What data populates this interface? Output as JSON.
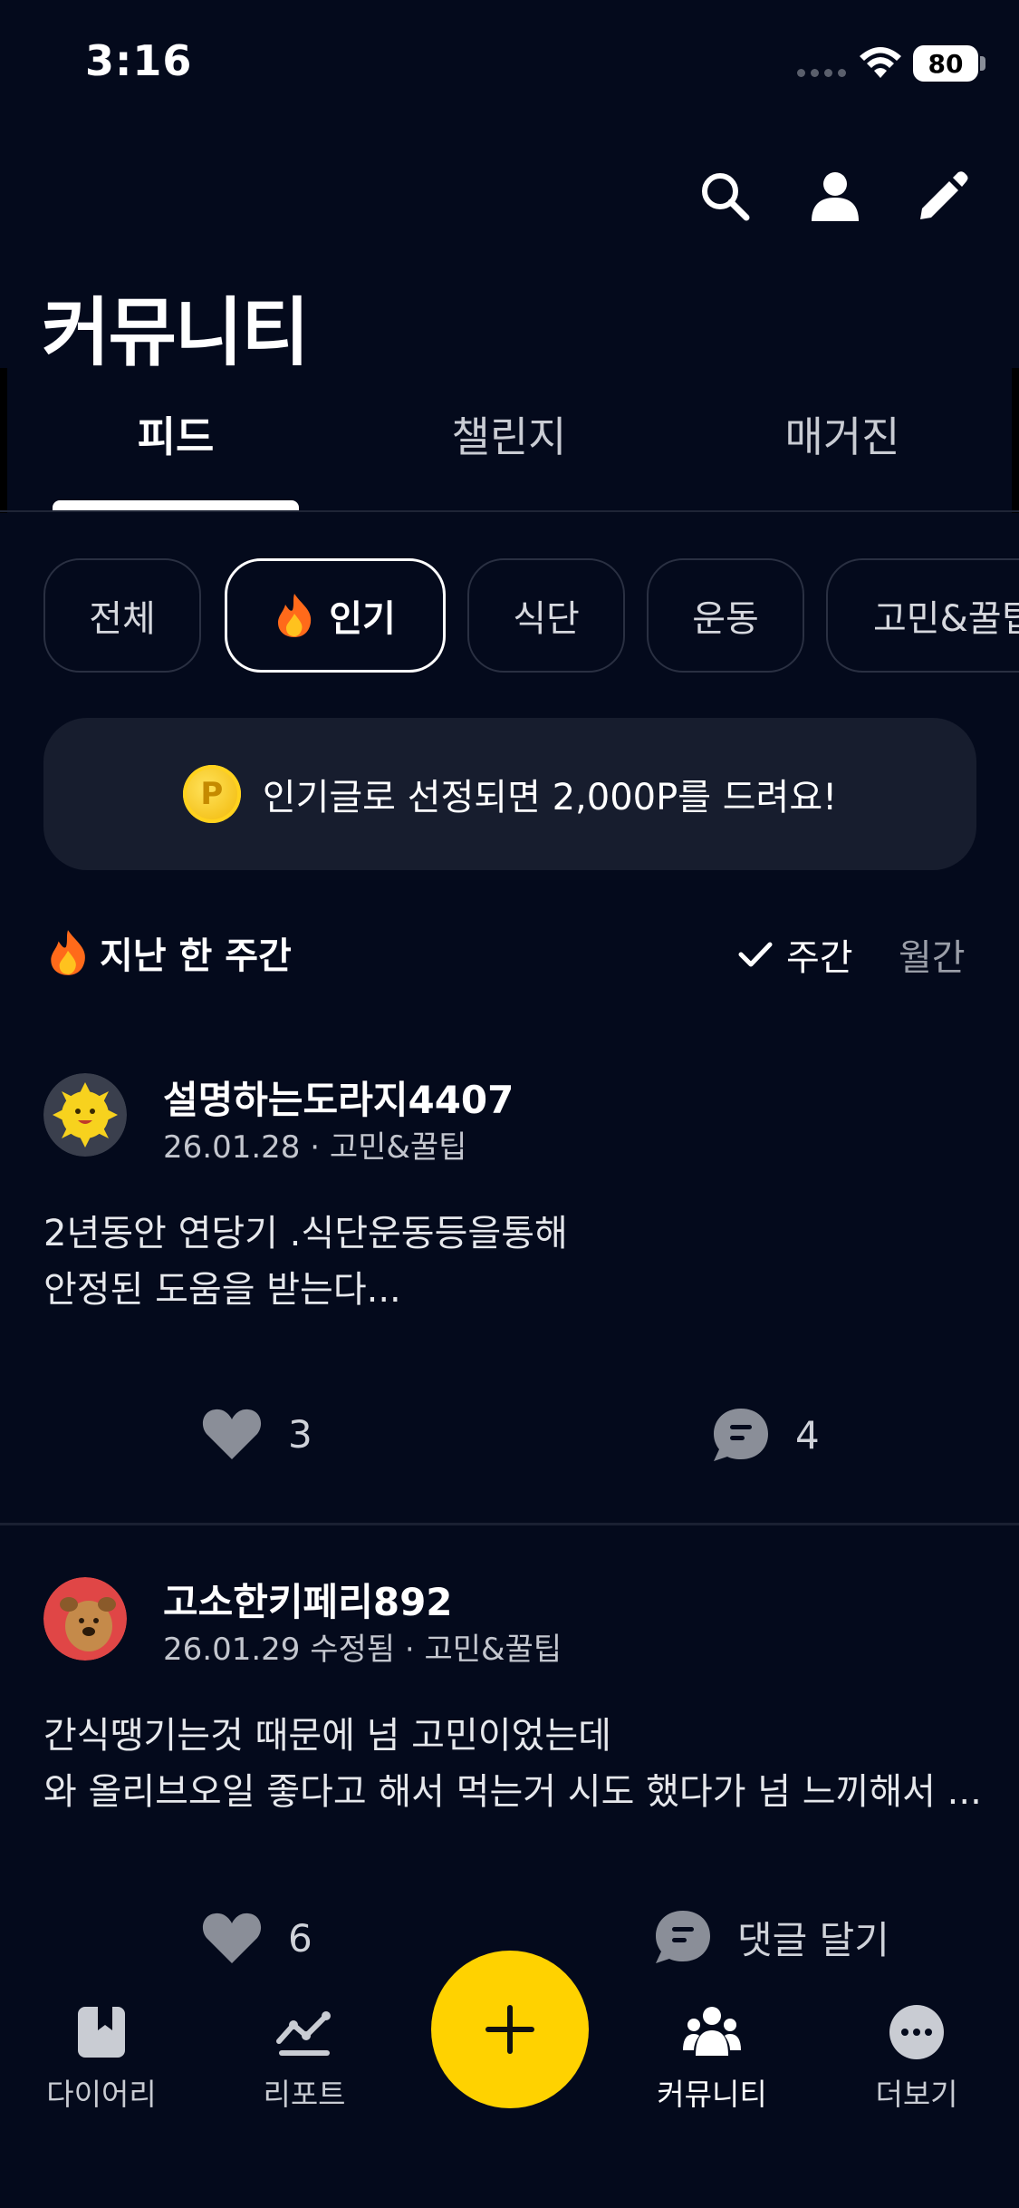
{
  "status_bar": {
    "time": "3:16",
    "battery": "80"
  },
  "header": {
    "title": "커뮤니티",
    "icons": [
      "search-icon",
      "profile-icon",
      "write-icon"
    ]
  },
  "tabs": [
    {
      "label": "피드",
      "active": true
    },
    {
      "label": "챌린지",
      "active": false
    },
    {
      "label": "매거진",
      "active": false
    }
  ],
  "chips": [
    {
      "label": "전체",
      "active": false
    },
    {
      "label": "인기",
      "active": true,
      "icon": "fire-icon"
    },
    {
      "label": "식단",
      "active": false
    },
    {
      "label": "운동",
      "active": false
    },
    {
      "label": "고민&꿀팁",
      "active": false
    }
  ],
  "banner": {
    "text": "인기글로 선정되면 2,000P를 드려요!",
    "coin_label": "P"
  },
  "section": {
    "title": "지난 한 주간",
    "periods": [
      {
        "label": "주간",
        "selected": true
      },
      {
        "label": "월간",
        "selected": false
      }
    ]
  },
  "posts": [
    {
      "author": "설명하는도라지4407",
      "meta": "26.01.28 · 고민&꿀팁",
      "lines": [
        "2년동안 연당기 .식단운동등을통해",
        "안정된 도움을 받는다..."
      ],
      "likes": "3",
      "comments": "4"
    },
    {
      "author": "고소한키페리892",
      "meta": "26.01.29 수정됨 · 고민&꿀팁",
      "lines": [
        "간식땡기는것 때문에 넘 고민이었는데",
        "와 올리브오일 좋다고 해서 먹는거 시도 했다가 넘 느끼해서 ..."
      ],
      "likes": "6",
      "comments": "댓글 달기"
    }
  ],
  "bottom_nav": [
    {
      "label": "다이어리",
      "icon": "diary-icon",
      "active": false
    },
    {
      "label": "리포트",
      "icon": "chart-icon",
      "active": false
    },
    {
      "label": "커뮤니티",
      "icon": "community-icon",
      "active": true
    },
    {
      "label": "더보기",
      "icon": "more-icon",
      "active": false
    }
  ],
  "colors": {
    "background": "#040a1c",
    "accent": "#ffd200",
    "banner": "#171d2e"
  }
}
